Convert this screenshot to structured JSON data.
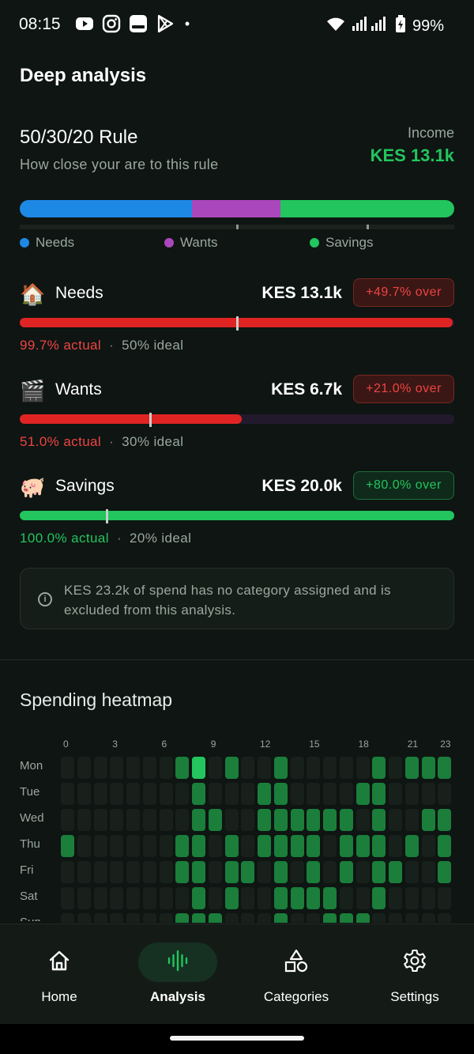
{
  "status_bar": {
    "time": "08:15",
    "dot": "•",
    "battery": "99%",
    "app_icons": [
      "youtube-icon",
      "instagram-icon",
      "notes-icon",
      "play-store-icon"
    ]
  },
  "header": {
    "title": "Deep analysis"
  },
  "rule": {
    "title": "50/30/20 Rule",
    "subtitle": "How close your are to this rule",
    "income_label": "Income",
    "income_value": "KES 13.1k"
  },
  "split_bar": {
    "segments": [
      {
        "name": "Needs",
        "share": 0.397,
        "color": "#1e88e5"
      },
      {
        "name": "Wants",
        "share": 0.203,
        "color": "#ab47bc"
      },
      {
        "name": "Savings",
        "share": 0.4,
        "color": "#22c55e"
      }
    ],
    "targets": [
      0.5,
      0.8
    ]
  },
  "legend": [
    {
      "label": "Needs",
      "color": "#1e88e5"
    },
    {
      "label": "Wants",
      "color": "#ab47bc"
    },
    {
      "label": "Savings",
      "color": "#22c55e"
    }
  ],
  "categories": [
    {
      "emoji": "🏠",
      "name": "Needs",
      "amount": "KES 13.1k",
      "badge": "+49.7% over",
      "badge_status": "bad",
      "actual_text": "99.7% actual",
      "separator": "·",
      "ideal_text": "50% ideal",
      "actual_fraction": 0.997,
      "ideal_fraction": 0.5,
      "fill_color": "#e02424",
      "icon_name": "house-icon"
    },
    {
      "emoji": "🎬",
      "name": "Wants",
      "amount": "KES 6.7k",
      "badge": "+21.0% over",
      "badge_status": "bad",
      "actual_text": "51.0% actual",
      "separator": "·",
      "ideal_text": "30% ideal",
      "actual_fraction": 0.51,
      "ideal_fraction": 0.3,
      "fill_color": "#e02424",
      "icon_name": "clapperboard-icon"
    },
    {
      "emoji": "🐖",
      "name": "Savings",
      "amount": "KES 20.0k",
      "badge": "+80.0% over",
      "badge_status": "good",
      "actual_text": "100.0% actual",
      "separator": "·",
      "ideal_text": "20% ideal",
      "actual_fraction": 1.0,
      "ideal_fraction": 0.2,
      "fill_color": "#22c55e",
      "icon_name": "piggy-bank-icon"
    }
  ],
  "notice": {
    "text": "KES 23.2k of spend has no category assigned and is excluded from this analysis.",
    "icon": "info-icon"
  },
  "heatmap": {
    "title": "Spending heatmap",
    "hour_labels": [
      {
        "hour": 0,
        "label": "0"
      },
      {
        "hour": 3,
        "label": "3"
      },
      {
        "hour": 6,
        "label": "6"
      },
      {
        "hour": 9,
        "label": "9"
      },
      {
        "hour": 12,
        "label": "12"
      },
      {
        "hour": 15,
        "label": "15"
      },
      {
        "hour": 18,
        "label": "18"
      },
      {
        "hour": 21,
        "label": "21"
      },
      {
        "hour": 23,
        "label": "23"
      }
    ],
    "days": [
      "Mon",
      "Tue",
      "Wed",
      "Thu",
      "Fri",
      "Sat",
      "Sun"
    ],
    "levels": [
      [
        0,
        0,
        0,
        0,
        0,
        0,
        0,
        2,
        4,
        0,
        2,
        0,
        0,
        2,
        0,
        0,
        0,
        0,
        0,
        2,
        0,
        2,
        2,
        2
      ],
      [
        0,
        0,
        0,
        0,
        0,
        0,
        0,
        0,
        2,
        0,
        0,
        0,
        2,
        2,
        0,
        0,
        0,
        0,
        2,
        2,
        0,
        0,
        0,
        0
      ],
      [
        0,
        0,
        0,
        0,
        0,
        0,
        0,
        0,
        2,
        2,
        0,
        0,
        2,
        2,
        2,
        2,
        2,
        2,
        0,
        2,
        0,
        0,
        2,
        2
      ],
      [
        2,
        0,
        0,
        0,
        0,
        0,
        0,
        2,
        2,
        0,
        2,
        0,
        2,
        2,
        2,
        2,
        0,
        2,
        2,
        2,
        0,
        2,
        0,
        2
      ],
      [
        0,
        0,
        0,
        0,
        0,
        0,
        0,
        2,
        2,
        0,
        2,
        2,
        0,
        2,
        0,
        2,
        0,
        2,
        0,
        2,
        2,
        0,
        0,
        2
      ],
      [
        0,
        0,
        0,
        0,
        0,
        0,
        0,
        0,
        2,
        0,
        2,
        0,
        0,
        2,
        2,
        2,
        2,
        0,
        0,
        2,
        0,
        0,
        0,
        0
      ],
      [
        0,
        0,
        0,
        0,
        0,
        0,
        0,
        2,
        2,
        2,
        0,
        0,
        0,
        2,
        0,
        0,
        2,
        2,
        2,
        0,
        0,
        0,
        0,
        0
      ]
    ],
    "level_colors": [
      "#18201c",
      "#155f2e",
      "#1b7e3b",
      "#20a04a",
      "#22c55e"
    ]
  },
  "bottom_nav": [
    {
      "label": "Home",
      "icon": "home-icon",
      "active": false
    },
    {
      "label": "Analysis",
      "icon": "analysis-icon",
      "active": true
    },
    {
      "label": "Categories",
      "icon": "categories-icon",
      "active": false
    },
    {
      "label": "Settings",
      "icon": "gear-icon",
      "active": false
    }
  ]
}
